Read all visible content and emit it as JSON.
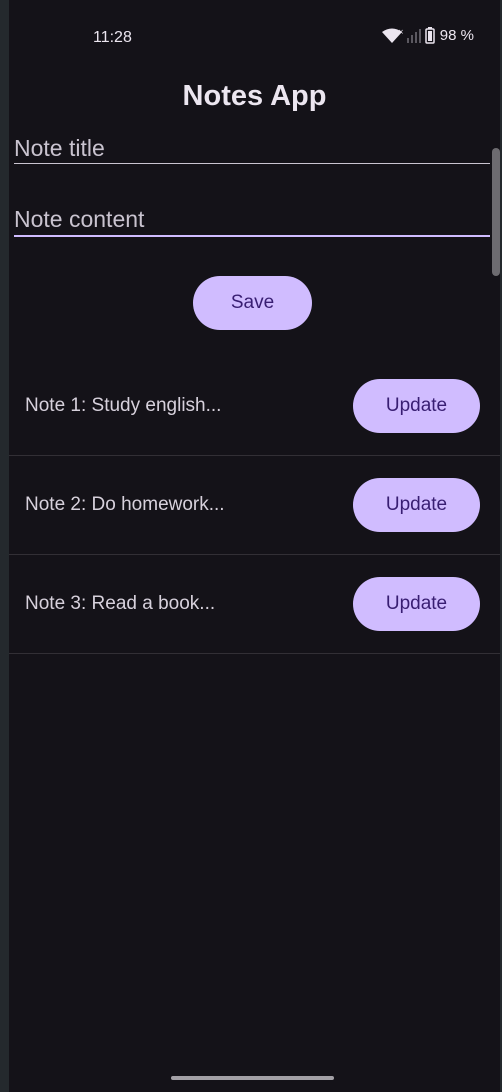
{
  "status_bar": {
    "time": "11:28",
    "battery": "98 %"
  },
  "app": {
    "title": "Notes App"
  },
  "form": {
    "title_placeholder": "Note title",
    "content_placeholder": "Note content",
    "save_label": "Save"
  },
  "notes": [
    {
      "label": "Note 1: Study english...",
      "action": "Update"
    },
    {
      "label": "Note 2: Do homework...",
      "action": "Update"
    },
    {
      "label": "Note 3: Read a book...",
      "action": "Update"
    }
  ],
  "colors": {
    "background": "#141218",
    "accent": "#d0bcff",
    "on_accent": "#381e72",
    "text": "#ece6f0"
  }
}
